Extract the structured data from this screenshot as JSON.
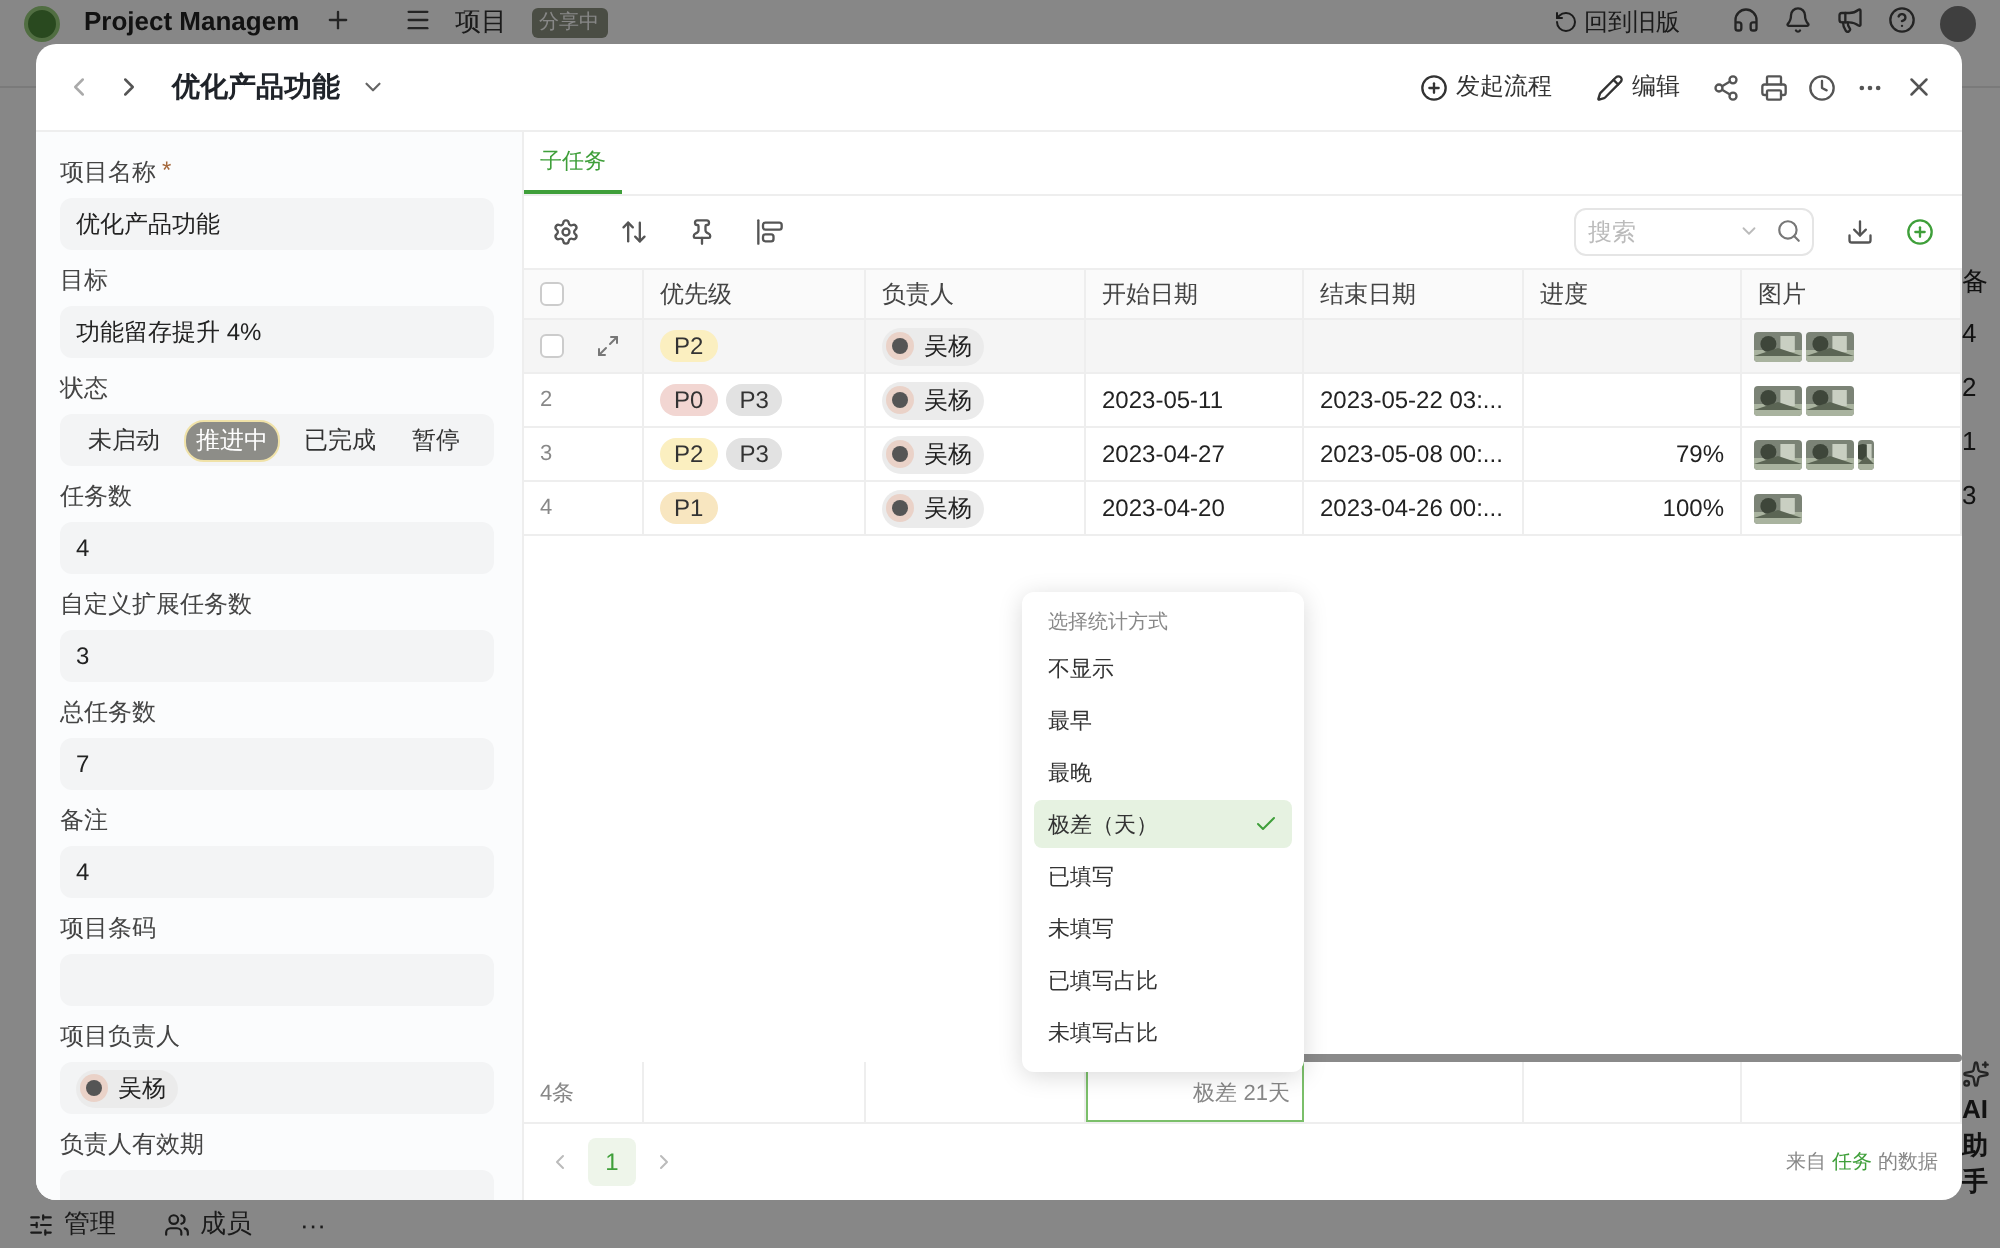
{
  "app": {
    "title": "Project Managem",
    "nav": "项目",
    "badge": "分享中",
    "old_version": "回到旧版",
    "side_column": {
      "header": "备",
      "values": [
        "4",
        "2",
        "1",
        "3"
      ]
    },
    "assistant": [
      "AI",
      "助",
      "手"
    ],
    "bottom": [
      {
        "kind": "manage",
        "label": "管理"
      },
      {
        "kind": "members",
        "label": "成员"
      },
      {
        "kind": "more",
        "label": "···"
      }
    ]
  },
  "modal": {
    "title": "优化产品功能",
    "actions": [
      {
        "kind": "flow",
        "label": "发起流程"
      },
      {
        "kind": "edit",
        "label": "编辑"
      }
    ]
  },
  "fields": [
    {
      "kind": "text",
      "label": "项目名称",
      "required_mark": "*",
      "value": "优化产品功能"
    },
    {
      "kind": "text",
      "label": "目标",
      "value": "功能留存提升 4%"
    },
    {
      "kind": "status",
      "label": "状态",
      "options": [
        {
          "label": "未启动",
          "selected": false
        },
        {
          "label": "推进中",
          "selected": true
        },
        {
          "label": "已完成",
          "selected": false
        },
        {
          "label": "暂停",
          "selected": false
        }
      ]
    },
    {
      "kind": "text",
      "label": "任务数",
      "value": "4"
    },
    {
      "kind": "text",
      "label": "自定义扩展任务数",
      "value": "3"
    },
    {
      "kind": "text",
      "label": "总任务数",
      "value": "7"
    },
    {
      "kind": "text",
      "label": "备注",
      "value": "4"
    },
    {
      "kind": "text",
      "label": "项目条码"
    },
    {
      "kind": "person",
      "label": "项目负责人",
      "value": "吴杨"
    },
    {
      "kind": "text",
      "label": "负责人有效期"
    }
  ],
  "tabs": [
    {
      "label": "子任务",
      "selected": true
    }
  ],
  "search": {
    "placeholder": "搜索"
  },
  "table": {
    "select_all": {
      "checked": false
    },
    "columns": [
      {
        "label": "优先级"
      },
      {
        "label": "负责人"
      },
      {
        "label": "开始日期",
        "summary": {
          "text": "极差 21天",
          "active": true
        }
      },
      {
        "label": "结束日期"
      },
      {
        "label": "进度"
      },
      {
        "label": "图片"
      }
    ],
    "rows": [
      {
        "hovered": true,
        "checked": false,
        "priorities": [
          {
            "label": "P2",
            "color": "#fbefc0"
          }
        ],
        "owner": "吴杨",
        "images": [
          {
            "kind": "picture"
          },
          {
            "kind": "picture"
          }
        ]
      },
      {
        "index": "2",
        "hovered": false,
        "checked": false,
        "priorities": [
          {
            "label": "P0",
            "color": "#f2d6d2"
          },
          {
            "label": "P3",
            "color": "#e2e2e2"
          }
        ],
        "owner": "吴杨",
        "start_date": "2023-05-11",
        "end_date": "2023-05-22 03:...",
        "images": [
          {
            "kind": "picture"
          },
          {
            "kind": "picture"
          }
        ]
      },
      {
        "index": "3",
        "hovered": false,
        "checked": false,
        "priorities": [
          {
            "label": "P2",
            "color": "#fbefc0"
          },
          {
            "label": "P3",
            "color": "#e2e2e2"
          }
        ],
        "owner": "吴杨",
        "start_date": "2023-04-27",
        "end_date": "2023-05-08 00:...",
        "progress": "79%",
        "images": [
          {
            "kind": "picture"
          },
          {
            "kind": "picture"
          },
          {
            "kind": "picture"
          }
        ]
      },
      {
        "index": "4",
        "hovered": false,
        "checked": false,
        "priorities": [
          {
            "label": "P1",
            "color": "#f8e6c0"
          }
        ],
        "owner": "吴杨",
        "start_date": "2023-04-20",
        "end_date": "2023-04-26 00:...",
        "progress": "100%",
        "images": [
          {
            "kind": "picture"
          }
        ]
      }
    ],
    "footer": {
      "count": "4条"
    }
  },
  "pagination": {
    "pages": [
      {
        "label": "1",
        "selected": true
      }
    ]
  },
  "source": {
    "prefix": "来自",
    "link": "任务",
    "suffix": "的数据"
  },
  "stat_menu": {
    "title": "选择统计方式",
    "options": [
      {
        "label": "不显示",
        "selected": false
      },
      {
        "label": "最早",
        "selected": false
      },
      {
        "label": "最晚",
        "selected": false
      },
      {
        "label": "极差（天）",
        "selected": true
      },
      {
        "label": "已填写",
        "selected": false
      },
      {
        "label": "未填写",
        "selected": false
      },
      {
        "label": "已填写占比",
        "selected": false
      },
      {
        "label": "未填写占比",
        "selected": false
      }
    ]
  }
}
